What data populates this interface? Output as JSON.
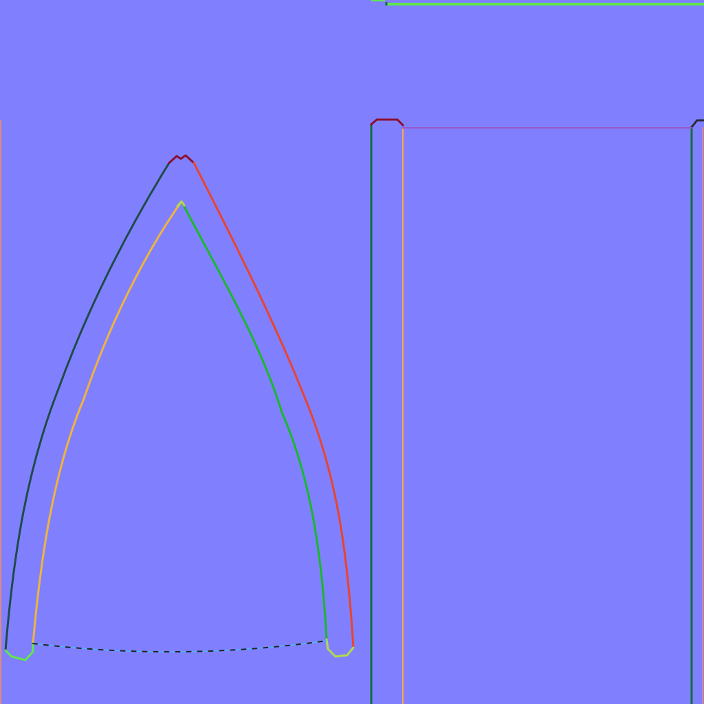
{
  "texture": {
    "kind": "normal-map UV layout",
    "background_color": "#8080ff"
  },
  "colors": {
    "dark_teal": "#1f4a48",
    "dark_green": "#146b3a",
    "green": "#19b82a",
    "lime": "#5fe84a",
    "yellow_green": "#b5d94a",
    "orange": "#ffa64d",
    "amber": "#f0b43c",
    "red": "#e8442e",
    "dark_red": "#8b0f2e",
    "purple": "#9a57c9",
    "cyan": "#4ab8ff",
    "salmon": "#e2897a"
  }
}
